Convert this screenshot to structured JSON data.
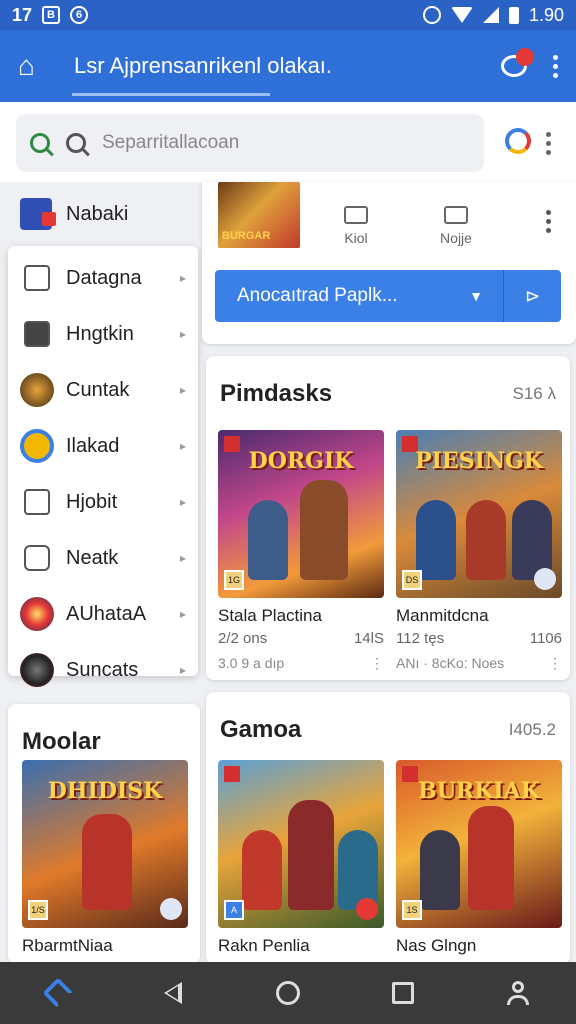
{
  "status_bar": {
    "time_left": "17",
    "time_right": "1.90",
    "icon_a": "B",
    "icon_b": "6"
  },
  "app_bar": {
    "title": "Lsr Ajprensanrikenl olakaı."
  },
  "search": {
    "placeholder": "Separritallacoan"
  },
  "drawer": {
    "header": "Nabaki",
    "items": [
      {
        "label": "Datagna",
        "icon": "file-icon"
      },
      {
        "label": "Hngtkin",
        "icon": "briefcase-icon"
      },
      {
        "label": "Cuntak",
        "icon": "game-avatar-icon"
      },
      {
        "label": "Ilakad",
        "icon": "alarm-icon"
      },
      {
        "label": "Hjobit",
        "icon": "document-icon"
      },
      {
        "label": "Neatk",
        "icon": "folder-icon"
      },
      {
        "label": "AUhataA",
        "icon": "burst-icon"
      },
      {
        "label": "Suncats",
        "icon": "helmet-icon"
      }
    ]
  },
  "top_card": {
    "thumb_text": "BURGAR",
    "actions": [
      {
        "label": "Kiol",
        "icon": "mail-icon"
      },
      {
        "label": "Nojje",
        "icon": "gamepad-icon"
      }
    ],
    "dropdown_label": "Anocaıtrad Paplk...",
    "send_icon": "send-icon"
  },
  "section_pimdasks": {
    "title": "Pimdasks",
    "meta": "S16 λ",
    "games": [
      {
        "title": "DORGIK",
        "name": "Stala Plactina",
        "count": "2/2 ons",
        "size": "14lS",
        "rating": "3.0 9 a dıp",
        "more": "⋮",
        "badge": "1G"
      },
      {
        "title": "PIESINGK",
        "name": "Manmitdcna",
        "count": "112 tęs",
        "size": "1106",
        "rating": "ANı · 8cKo: Noes",
        "more": "⋮",
        "badge": "DS"
      }
    ]
  },
  "section_moolar": {
    "title": "Moolar",
    "games": [
      {
        "title": "DHIDISK",
        "name": "RbarmtNiaa",
        "badge": "1/S"
      }
    ]
  },
  "section_gamoa": {
    "title": "Gamoa",
    "meta": "I405.2",
    "games": [
      {
        "title": "",
        "name": "Rakn Penlia",
        "badge": "A"
      },
      {
        "title": "BURKIAK",
        "name": "Nas Glngn",
        "badge": "1S"
      }
    ]
  },
  "colors": {
    "primary": "#2f6fd8",
    "accent": "#3b80e6",
    "status": "#2b62c6"
  }
}
